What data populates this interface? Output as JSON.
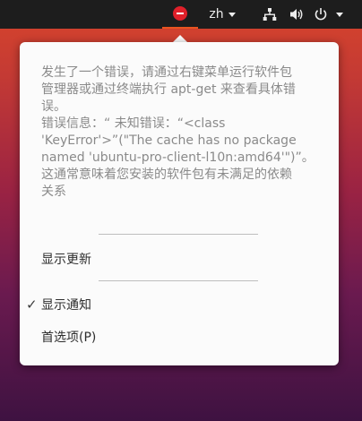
{
  "panel": {
    "language": "zh",
    "notifier_icon": "error-circle-icon",
    "network_icon": "network-wired-icon",
    "volume_icon": "volume-icon",
    "power_icon": "power-icon"
  },
  "menu": {
    "error_message": "发生了一个错误，请通过右键菜单运行软件包\n管理器或通过终端执行 apt-get 来查看具体错\n误。\n错误信息：“ 未知错误：“<class\n'KeyError'>”(\"The cache has no package\nnamed 'ubuntu-pro-client-l10n:amd64'\")”。\n这通常意味着您安装的软件包有未满足的依赖\n关系",
    "show_updates_label": "显示更新",
    "show_notifications_label": "显示通知",
    "show_notifications_checked": true,
    "check_mark": "✓",
    "preferences_label": "首选项(P)"
  },
  "colors": {
    "panel_bg": "#1d1d1d",
    "menu_bg": "#fbfbfb",
    "accent": "#e95420",
    "error_red": "#e0202a",
    "muted_text": "#8a8a8a"
  }
}
